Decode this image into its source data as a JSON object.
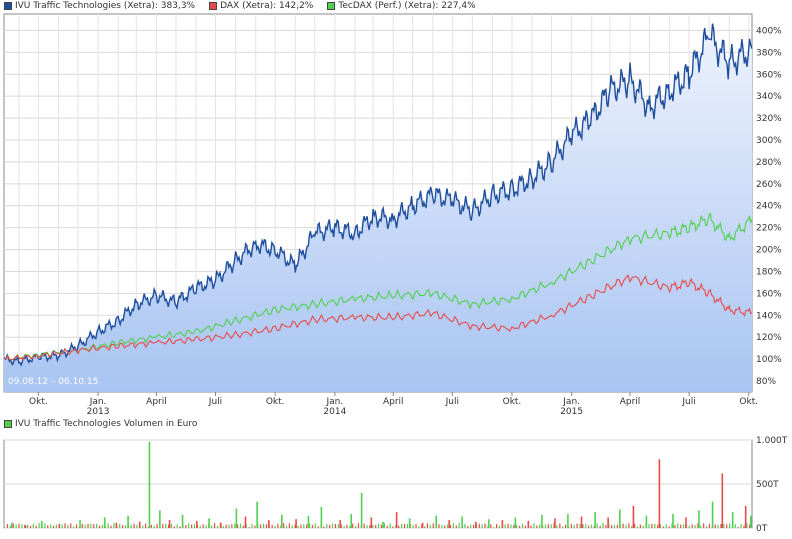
{
  "legend": [
    {
      "label": "IVU Traffic Technologies (Xetra): 383,3%",
      "color": "#1f4e9e"
    },
    {
      "label": "DAX (Xetra): 142,2%",
      "color": "#e84a4a"
    },
    {
      "label": "TecDAX (Perf.) (Xetra): 227,4%",
      "color": "#4fd04f"
    }
  ],
  "date_range_label": "09.08.12 – 06.10.15",
  "volume_legend": {
    "label": "IVU Traffic Technologies Volumen in Euro",
    "color": "#4fd04f"
  },
  "chart_data": [
    {
      "type": "line",
      "x_ticks": [
        {
          "label": "Okt.",
          "year": "",
          "date": "2012-10-01"
        },
        {
          "label": "Jan.",
          "year": "2013",
          "date": "2013-01-01"
        },
        {
          "label": "April",
          "year": "",
          "date": "2013-04-01"
        },
        {
          "label": "Juli",
          "year": "",
          "date": "2013-07-01"
        },
        {
          "label": "Okt.",
          "year": "",
          "date": "2013-10-01"
        },
        {
          "label": "Jan.",
          "year": "2014",
          "date": "2014-01-01"
        },
        {
          "label": "April",
          "year": "",
          "date": "2014-04-01"
        },
        {
          "label": "Juli",
          "year": "",
          "date": "2014-07-01"
        },
        {
          "label": "Okt.",
          "year": "",
          "date": "2014-10-01"
        },
        {
          "label": "Jan.",
          "year": "2015",
          "date": "2015-01-01"
        },
        {
          "label": "April",
          "year": "",
          "date": "2015-04-01"
        },
        {
          "label": "Juli",
          "year": "",
          "date": "2015-07-01"
        },
        {
          "label": "Okt.",
          "year": "",
          "date": "2015-10-01"
        }
      ],
      "x_range": [
        "2012-08-09",
        "2015-10-06"
      ],
      "y_ticks": [
        "80%",
        "100%",
        "120%",
        "140%",
        "160%",
        "180%",
        "200%",
        "220%",
        "240%",
        "260%",
        "280%",
        "300%",
        "320%",
        "340%",
        "360%",
        "380%",
        "400%"
      ],
      "ylim": [
        70,
        415
      ],
      "grid": true,
      "legend_position": "top-left",
      "series": [
        {
          "name": "IVU Traffic Technologies (Xetra): 383,3%",
          "color": "#1f4e9e",
          "area": true,
          "points": [
            [
              "2012-08-09",
              100
            ],
            [
              "2012-09-01",
              98
            ],
            [
              "2012-10-01",
              102
            ],
            [
              "2012-11-01",
              103
            ],
            [
              "2012-12-01",
              112
            ],
            [
              "2013-01-01",
              125
            ],
            [
              "2013-02-01",
              135
            ],
            [
              "2013-03-01",
              150
            ],
            [
              "2013-04-01",
              158
            ],
            [
              "2013-05-01",
              152
            ],
            [
              "2013-06-01",
              165
            ],
            [
              "2013-07-01",
              172
            ],
            [
              "2013-08-01",
              190
            ],
            [
              "2013-09-01",
              205
            ],
            [
              "2013-10-01",
              200
            ],
            [
              "2013-11-01",
              185
            ],
            [
              "2013-12-01",
              215
            ],
            [
              "2014-01-01",
              220
            ],
            [
              "2014-02-01",
              215
            ],
            [
              "2014-03-01",
              230
            ],
            [
              "2014-04-01",
              228
            ],
            [
              "2014-05-01",
              240
            ],
            [
              "2014-06-01",
              250
            ],
            [
              "2014-07-01",
              245
            ],
            [
              "2014-08-01",
              235
            ],
            [
              "2014-09-01",
              250
            ],
            [
              "2014-10-01",
              255
            ],
            [
              "2014-11-01",
              265
            ],
            [
              "2014-12-01",
              280
            ],
            [
              "2015-01-01",
              305
            ],
            [
              "2015-02-01",
              320
            ],
            [
              "2015-03-01",
              345
            ],
            [
              "2015-04-01",
              355
            ],
            [
              "2015-05-01",
              330
            ],
            [
              "2015-06-01",
              345
            ],
            [
              "2015-07-01",
              360
            ],
            [
              "2015-08-01",
              395
            ],
            [
              "2015-09-01",
              370
            ],
            [
              "2015-10-06",
              383.3
            ]
          ]
        },
        {
          "name": "TecDAX (Perf.) (Xetra): 227,4%",
          "color": "#4fd04f",
          "area": false,
          "points": [
            [
              "2012-08-09",
              100
            ],
            [
              "2012-10-01",
              104
            ],
            [
              "2012-12-01",
              108
            ],
            [
              "2013-02-01",
              115
            ],
            [
              "2013-04-01",
              120
            ],
            [
              "2013-06-01",
              125
            ],
            [
              "2013-08-01",
              135
            ],
            [
              "2013-10-01",
              145
            ],
            [
              "2013-12-01",
              150
            ],
            [
              "2014-02-01",
              155
            ],
            [
              "2014-04-01",
              158
            ],
            [
              "2014-06-01",
              160
            ],
            [
              "2014-08-01",
              150
            ],
            [
              "2014-10-01",
              155
            ],
            [
              "2014-12-01",
              170
            ],
            [
              "2015-02-01",
              190
            ],
            [
              "2015-04-01",
              210
            ],
            [
              "2015-06-01",
              215
            ],
            [
              "2015-07-01",
              220
            ],
            [
              "2015-08-01",
              228
            ],
            [
              "2015-09-01",
              210
            ],
            [
              "2015-10-06",
              227.4
            ]
          ]
        },
        {
          "name": "DAX (Xetra): 142,2%",
          "color": "#e84a4a",
          "area": false,
          "points": [
            [
              "2012-08-09",
              100
            ],
            [
              "2012-10-01",
              103
            ],
            [
              "2012-12-01",
              108
            ],
            [
              "2013-02-01",
              112
            ],
            [
              "2013-04-01",
              115
            ],
            [
              "2013-06-01",
              118
            ],
            [
              "2013-08-01",
              122
            ],
            [
              "2013-10-01",
              128
            ],
            [
              "2013-12-01",
              136
            ],
            [
              "2014-02-01",
              138
            ],
            [
              "2014-04-01",
              138
            ],
            [
              "2014-06-01",
              142
            ],
            [
              "2014-08-01",
              130
            ],
            [
              "2014-10-01",
              128
            ],
            [
              "2014-12-01",
              140
            ],
            [
              "2015-02-01",
              158
            ],
            [
              "2015-04-01",
              175
            ],
            [
              "2015-06-01",
              165
            ],
            [
              "2015-07-01",
              170
            ],
            [
              "2015-08-01",
              160
            ],
            [
              "2015-09-01",
              145
            ],
            [
              "2015-10-06",
              142.2
            ]
          ]
        }
      ]
    },
    {
      "type": "bar",
      "title": "IVU Traffic Technologies Volumen in Euro",
      "y_ticks": [
        "0T",
        "500T",
        "1.000T"
      ],
      "ylim": [
        0,
        1000
      ],
      "grid": true,
      "bar_colors": [
        "#4fd04f",
        "#e84a4a"
      ],
      "bars": [
        [
          "2012-08-20",
          60,
          "g"
        ],
        [
          "2012-09-10",
          30,
          "r"
        ],
        [
          "2012-10-05",
          80,
          "g"
        ],
        [
          "2012-11-01",
          45,
          "r"
        ],
        [
          "2012-12-03",
          90,
          "g"
        ],
        [
          "2013-01-10",
          120,
          "g"
        ],
        [
          "2013-01-28",
          60,
          "r"
        ],
        [
          "2013-02-15",
          140,
          "g"
        ],
        [
          "2013-03-05",
          70,
          "r"
        ],
        [
          "2013-03-20",
          980,
          "g"
        ],
        [
          "2013-04-05",
          200,
          "g"
        ],
        [
          "2013-04-20",
          90,
          "r"
        ],
        [
          "2013-05-10",
          150,
          "g"
        ],
        [
          "2013-06-01",
          80,
          "r"
        ],
        [
          "2013-06-20",
          110,
          "g"
        ],
        [
          "2013-07-08",
          60,
          "r"
        ],
        [
          "2013-08-01",
          220,
          "g"
        ],
        [
          "2013-08-15",
          130,
          "r"
        ],
        [
          "2013-09-02",
          300,
          "g"
        ],
        [
          "2013-09-20",
          90,
          "r"
        ],
        [
          "2013-10-10",
          150,
          "g"
        ],
        [
          "2013-11-01",
          100,
          "r"
        ],
        [
          "2013-11-20",
          140,
          "g"
        ],
        [
          "2013-12-10",
          240,
          "g"
        ],
        [
          "2014-01-08",
          90,
          "r"
        ],
        [
          "2014-01-25",
          160,
          "g"
        ],
        [
          "2014-02-10",
          400,
          "g"
        ],
        [
          "2014-02-25",
          120,
          "r"
        ],
        [
          "2014-03-15",
          70,
          "g"
        ],
        [
          "2014-04-05",
          180,
          "r"
        ],
        [
          "2014-04-25",
          110,
          "g"
        ],
        [
          "2014-05-15",
          60,
          "r"
        ],
        [
          "2014-06-05",
          140,
          "g"
        ],
        [
          "2014-06-25",
          90,
          "r"
        ],
        [
          "2014-07-15",
          130,
          "g"
        ],
        [
          "2014-08-05",
          70,
          "r"
        ],
        [
          "2014-08-25",
          100,
          "g"
        ],
        [
          "2014-09-15",
          90,
          "r"
        ],
        [
          "2014-10-05",
          120,
          "g"
        ],
        [
          "2014-10-25",
          80,
          "r"
        ],
        [
          "2014-11-15",
          150,
          "g"
        ],
        [
          "2014-12-05",
          110,
          "r"
        ],
        [
          "2014-12-25",
          160,
          "g"
        ],
        [
          "2015-01-15",
          130,
          "r"
        ],
        [
          "2015-02-05",
          180,
          "g"
        ],
        [
          "2015-02-25",
          120,
          "r"
        ],
        [
          "2015-03-15",
          210,
          "g"
        ],
        [
          "2015-04-05",
          250,
          "r"
        ],
        [
          "2015-04-25",
          140,
          "g"
        ],
        [
          "2015-05-15",
          780,
          "r"
        ],
        [
          "2015-06-05",
          160,
          "g"
        ],
        [
          "2015-06-25",
          120,
          "r"
        ],
        [
          "2015-07-15",
          200,
          "g"
        ],
        [
          "2015-08-05",
          300,
          "g"
        ],
        [
          "2015-08-20",
          620,
          "r"
        ],
        [
          "2015-09-05",
          180,
          "g"
        ],
        [
          "2015-09-25",
          250,
          "r"
        ],
        [
          "2015-10-03",
          140,
          "g"
        ]
      ]
    }
  ]
}
